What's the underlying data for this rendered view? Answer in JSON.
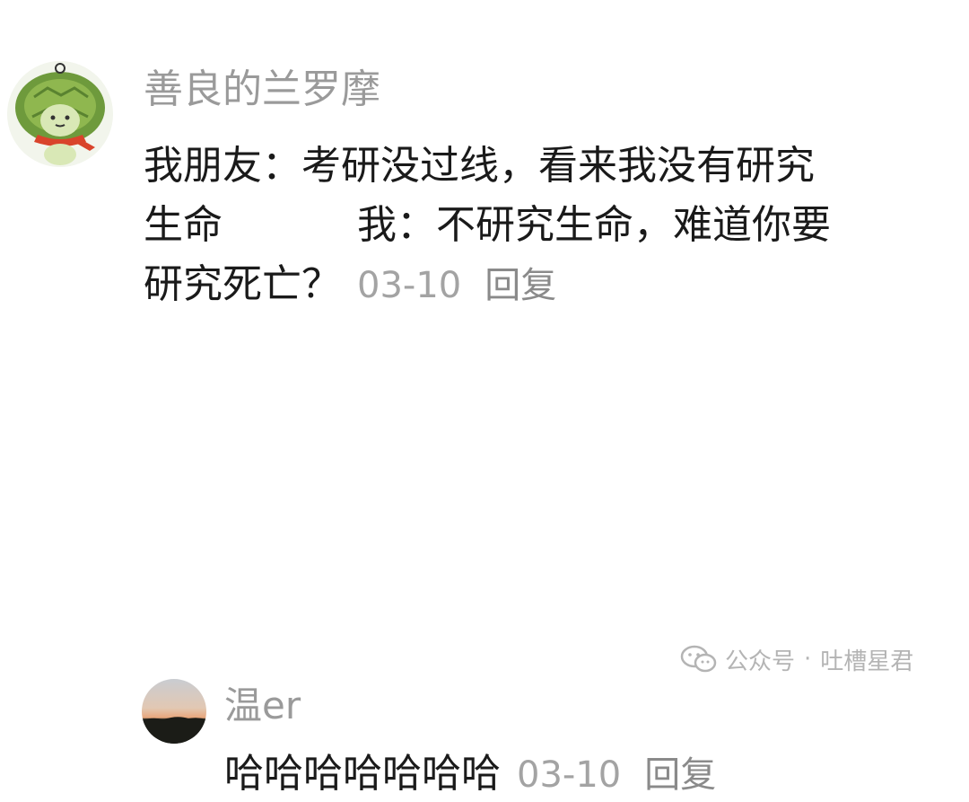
{
  "comment": {
    "username": "善良的兰罗摩",
    "lines": [
      "我朋友：考研没过线，看来我没有研究",
      "生命",
      "我：不研究生命，难道你要",
      "研究死亡？"
    ],
    "date": "03-10",
    "reply_label": "回复"
  },
  "reply_comment": {
    "username": "温er",
    "text": "哈哈哈哈哈哈哈",
    "date": "03-10",
    "reply_label": "回复"
  },
  "watermark": {
    "channel": "公众号",
    "separator": "·",
    "account": "吐槽星君"
  }
}
